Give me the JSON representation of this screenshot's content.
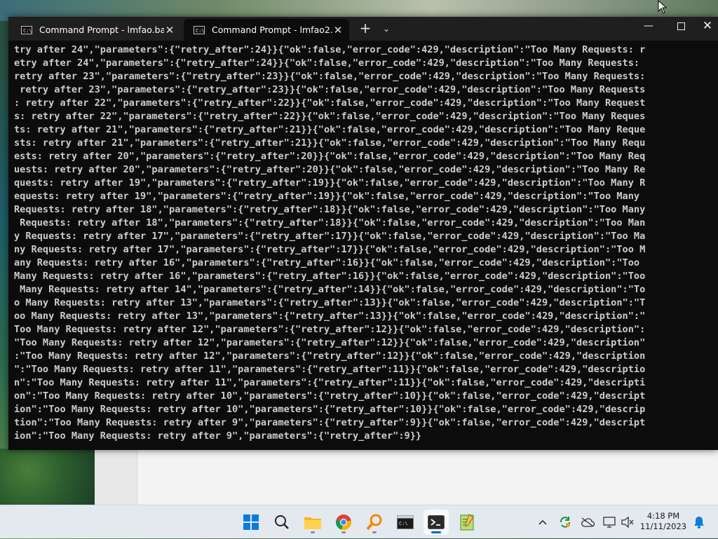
{
  "terminal": {
    "tabs": [
      {
        "label": "Command Prompt - lmfao.bat",
        "active": false
      },
      {
        "label": "Command Prompt - lmfao2.bat",
        "active": true
      }
    ],
    "console_lines": [
      "try after 24\",\"parameters\":{\"retry_after\":24}}{\"ok\":false,\"error_code\":429,\"description\":\"Too Many Requests: r",
      "etry after 24\",\"parameters\":{\"retry_after\":24}}{\"ok\":false,\"error_code\":429,\"description\":\"Too Many Requests:",
      "retry after 23\",\"parameters\":{\"retry_after\":23}}{\"ok\":false,\"error_code\":429,\"description\":\"Too Many Requests:",
      " retry after 23\",\"parameters\":{\"retry_after\":23}}{\"ok\":false,\"error_code\":429,\"description\":\"Too Many Requests",
      ": retry after 22\",\"parameters\":{\"retry_after\":22}}{\"ok\":false,\"error_code\":429,\"description\":\"Too Many Request",
      "s: retry after 22\",\"parameters\":{\"retry_after\":22}}{\"ok\":false,\"error_code\":429,\"description\":\"Too Many Reques",
      "ts: retry after 21\",\"parameters\":{\"retry_after\":21}}{\"ok\":false,\"error_code\":429,\"description\":\"Too Many Reque",
      "sts: retry after 21\",\"parameters\":{\"retry_after\":21}}{\"ok\":false,\"error_code\":429,\"description\":\"Too Many Requ",
      "ests: retry after 20\",\"parameters\":{\"retry_after\":20}}{\"ok\":false,\"error_code\":429,\"description\":\"Too Many Req",
      "uests: retry after 20\",\"parameters\":{\"retry_after\":20}}{\"ok\":false,\"error_code\":429,\"description\":\"Too Many Re",
      "quests: retry after 19\",\"parameters\":{\"retry_after\":19}}{\"ok\":false,\"error_code\":429,\"description\":\"Too Many R",
      "equests: retry after 19\",\"parameters\":{\"retry_after\":19}}{\"ok\":false,\"error_code\":429,\"description\":\"Too Many",
      "Requests: retry after 18\",\"parameters\":{\"retry_after\":18}}{\"ok\":false,\"error_code\":429,\"description\":\"Too Many",
      " Requests: retry after 18\",\"parameters\":{\"retry_after\":18}}{\"ok\":false,\"error_code\":429,\"description\":\"Too Man",
      "y Requests: retry after 17\",\"parameters\":{\"retry_after\":17}}{\"ok\":false,\"error_code\":429,\"description\":\"Too Ma",
      "ny Requests: retry after 17\",\"parameters\":{\"retry_after\":17}}{\"ok\":false,\"error_code\":429,\"description\":\"Too M",
      "any Requests: retry after 16\",\"parameters\":{\"retry_after\":16}}{\"ok\":false,\"error_code\":429,\"description\":\"Too",
      "Many Requests: retry after 16\",\"parameters\":{\"retry_after\":16}}{\"ok\":false,\"error_code\":429,\"description\":\"Too",
      " Many Requests: retry after 14\",\"parameters\":{\"retry_after\":14}}{\"ok\":false,\"error_code\":429,\"description\":\"To",
      "o Many Requests: retry after 13\",\"parameters\":{\"retry_after\":13}}{\"ok\":false,\"error_code\":429,\"description\":\"T",
      "oo Many Requests: retry after 13\",\"parameters\":{\"retry_after\":13}}{\"ok\":false,\"error_code\":429,\"description\":\"",
      "Too Many Requests: retry after 12\",\"parameters\":{\"retry_after\":12}}{\"ok\":false,\"error_code\":429,\"description\":",
      "\"Too Many Requests: retry after 12\",\"parameters\":{\"retry_after\":12}}{\"ok\":false,\"error_code\":429,\"description\"",
      ":\"Too Many Requests: retry after 12\",\"parameters\":{\"retry_after\":12}}{\"ok\":false,\"error_code\":429,\"description",
      "\":\"Too Many Requests: retry after 11\",\"parameters\":{\"retry_after\":11}}{\"ok\":false,\"error_code\":429,\"descriptio",
      "n\":\"Too Many Requests: retry after 11\",\"parameters\":{\"retry_after\":11}}{\"ok\":false,\"error_code\":429,\"descripti",
      "on\":\"Too Many Requests: retry after 10\",\"parameters\":{\"retry_after\":10}}{\"ok\":false,\"error_code\":429,\"descript",
      "ion\":\"Too Many Requests: retry after 10\",\"parameters\":{\"retry_after\":10}}{\"ok\":false,\"error_code\":429,\"descrip",
      "tion\":\"Too Many Requests: retry after 9\",\"parameters\":{\"retry_after\":9}}{\"ok\":false,\"error_code\":429,\"descript",
      "ion\":\"Too Many Requests: retry after 9\",\"parameters\":{\"retry_after\":9}}"
    ]
  },
  "taskbar": {
    "apps": [
      {
        "name": "start",
        "icon": "windows-logo-icon",
        "active": false
      },
      {
        "name": "search",
        "icon": "search-icon",
        "active": false
      },
      {
        "name": "file-explorer",
        "icon": "folder-icon",
        "active": false
      },
      {
        "name": "chrome",
        "icon": "chrome-icon",
        "active": false
      },
      {
        "name": "search-everything",
        "icon": "magnifier-orange-icon",
        "active": false
      },
      {
        "name": "command-prompt",
        "icon": "cmd-icon",
        "active": false
      },
      {
        "name": "terminal",
        "icon": "terminal-icon",
        "active": true
      },
      {
        "name": "notepad-plus-plus",
        "icon": "notepad-icon",
        "active": false
      }
    ],
    "tray_icons": [
      "chevron-up-icon",
      "sync-icon",
      "cloud-offline-icon",
      "network-icon",
      "volume-muted-icon"
    ],
    "clock": {
      "time": "4:18 PM",
      "date": "11/11/2023"
    }
  },
  "colors": {
    "console_bg": "#0c0c0c",
    "console_fg": "#cccccc",
    "titlebar_bg": "#1f1f1f",
    "taskbar_bg": "#e4e9f0",
    "accent": "#0067c0"
  }
}
